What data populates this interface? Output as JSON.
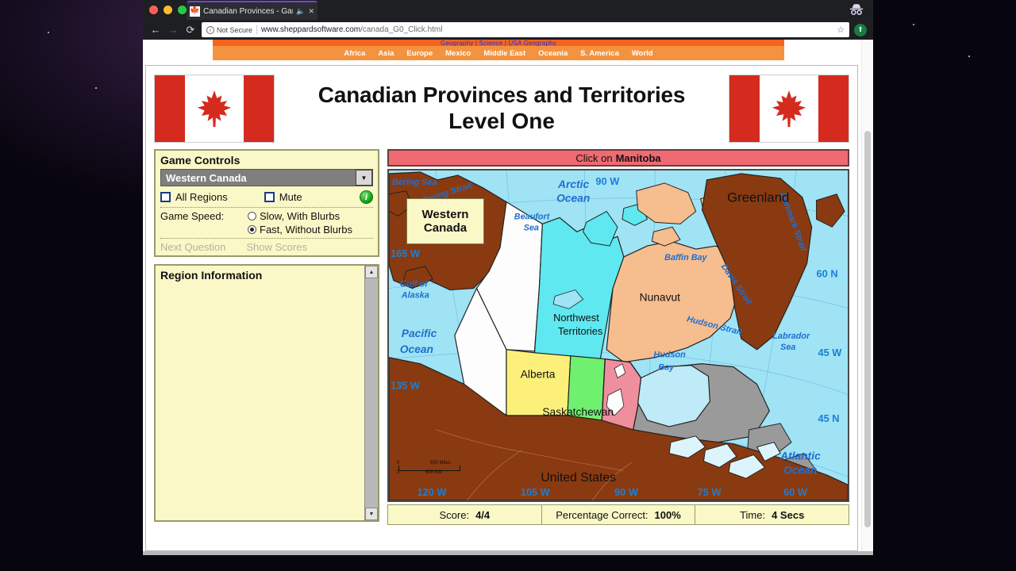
{
  "browser": {
    "tab_title": "Canadian Provinces - Game",
    "tab_audio_icon": "speaker-icon",
    "tab_close_icon": "close-icon",
    "back_icon": "back-arrow-icon",
    "forward_icon": "forward-arrow-icon",
    "reload_icon": "reload-icon",
    "security_label": "Not Secure",
    "url_domain": "www.sheppardsoftware.com",
    "url_path": "/canada_G0_Click.html",
    "bookmark_icon": "star-icon",
    "download_icon": "download-icon",
    "incognito_icon": "incognito-icon"
  },
  "site_nav": {
    "top_links": "Geography  |  Science  |  USA Geography",
    "items": [
      "Africa",
      "Asia",
      "Europe",
      "Mexico",
      "Middle East",
      "Oceania",
      "S. America",
      "World"
    ]
  },
  "header": {
    "title_line1": "Canadian Provinces and Territories",
    "title_line2": "Level One",
    "flag_left_name": "canada-flag-icon",
    "flag_right_name": "canada-flag-icon"
  },
  "controls": {
    "heading": "Game Controls",
    "region_selected": "Western Canada",
    "dropdown_icon": "chevron-down-icon",
    "all_regions_label": "All Regions",
    "all_regions_checked": false,
    "mute_label": "Mute",
    "mute_checked": false,
    "info_icon": "info-icon",
    "speed_label": "Game Speed:",
    "speed_slow": "Slow, With Blurbs",
    "speed_fast": "Fast, Without Blurbs",
    "speed_selected": "Fast, Without Blurbs",
    "next_question": "Next Question",
    "show_scores": "Show Scores"
  },
  "region_info": {
    "heading": "Region Information",
    "body": "",
    "scroll_up_icon": "triangle-up-icon",
    "scroll_down_icon": "triangle-down-icon"
  },
  "question": {
    "prompt": "Click on",
    "target": "Manitoba"
  },
  "map": {
    "badge_line1": "Western",
    "badge_line2": "Canada",
    "cursor_icon": "mouse-cursor-icon",
    "scale_top_left": "0",
    "scale_top_right": "500 Miles",
    "scale_bottom_left": "0",
    "scale_bottom_right": "500 KM",
    "sea_labels": [
      "Bering Sea",
      "Bering Strait",
      "Beaufort Sea",
      "Arctic Ocean",
      "Gulf of Alaska",
      "Pacific Ocean",
      "Baffin Bay",
      "Denmark Strait",
      "Davis Strait",
      "Hudson Strait",
      "Hudson Bay",
      "Labrador Sea",
      "Atlantic Ocean"
    ],
    "land_labels": [
      "Greenland",
      "Nunavut",
      "Northwest Territories",
      "Alberta",
      "Saskatchewan",
      "United States"
    ],
    "coordinates": [
      "90 W",
      "60 N",
      "45 W",
      "45 N",
      "135 W",
      "165 W",
      "120 W",
      "105 W",
      "90 W",
      "75 W",
      "60 W"
    ],
    "colors": {
      "ocean": "#9fe3f5",
      "foreign_land": "#8a3a10",
      "nunavut": "#f6bd8f",
      "northwest_territories": "#5fe8ef",
      "alberta": "#fcf07a",
      "saskatchewan": "#6ff06f",
      "manitoba_highlight": "#ef8f9d",
      "ontario_quebec": "#9a9a9a",
      "yukon": "#fdfdfd"
    }
  },
  "scores": {
    "score_label": "Score:",
    "score_value": "4/4",
    "percent_label": "Percentage Correct:",
    "percent_value": "100%",
    "time_label": "Time:",
    "time_value": "4 Secs"
  }
}
